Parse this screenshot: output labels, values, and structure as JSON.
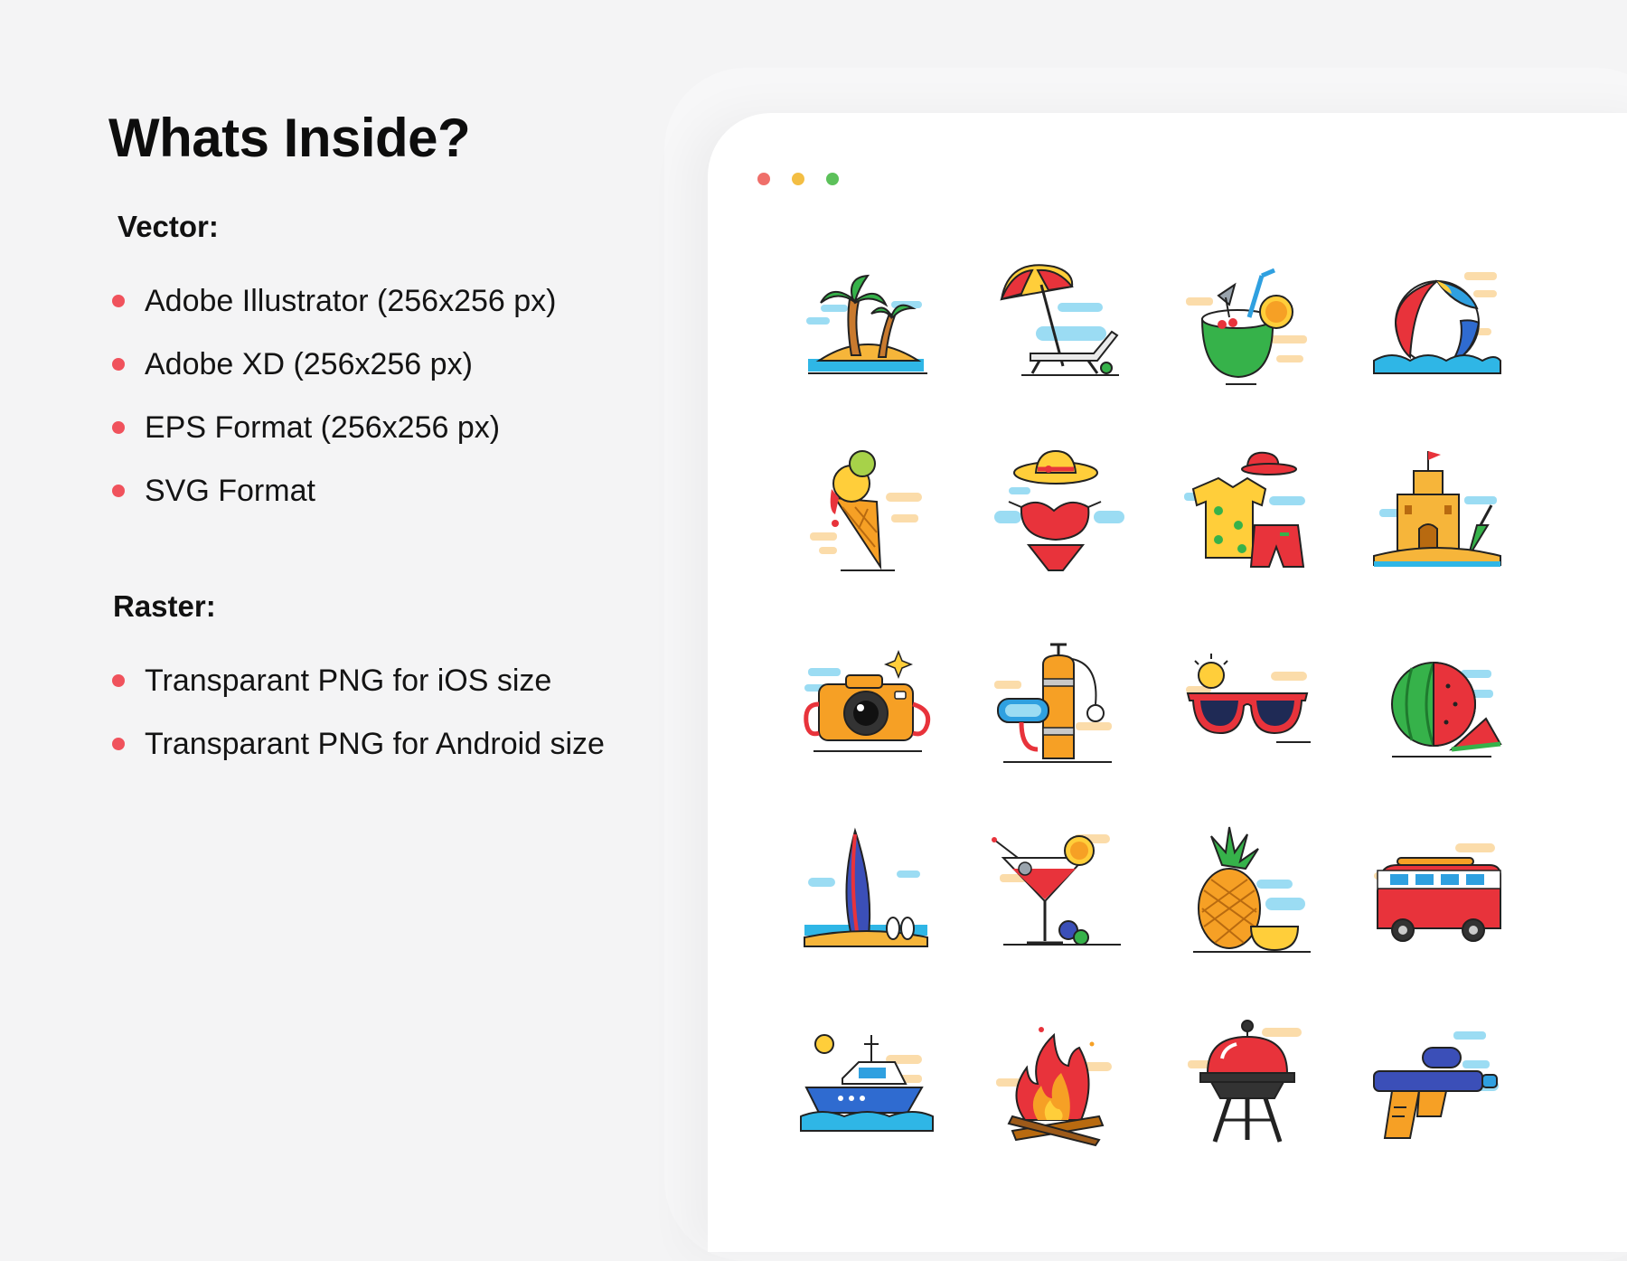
{
  "heading": "Whats Inside?",
  "vector": {
    "title": "Vector:",
    "items": [
      "Adobe Illustrator (256x256 px)",
      "Adobe XD (256x256 px)",
      "EPS Format (256x256 px)",
      "SVG Format"
    ]
  },
  "raster": {
    "title": "Raster:",
    "items": [
      "Transparant PNG for iOS size",
      "Transparant PNG for Android size"
    ]
  },
  "window_dots": [
    "#ef6f6a",
    "#f3be43",
    "#5cc15a"
  ],
  "colors": {
    "bullet": "#f0525c",
    "heading": "#0d0d0d",
    "text": "#141414"
  },
  "icons": [
    "palm-island-icon",
    "beach-umbrella-chair-icon",
    "coconut-drink-icon",
    "beach-ball-icon",
    "ice-cream-cone-icon",
    "bikini-hat-icon",
    "hawaiian-shirt-shorts-icon",
    "sand-castle-icon",
    "camera-icon",
    "scuba-tank-mask-icon",
    "sunglasses-icon",
    "watermelon-icon",
    "surfboard-icon",
    "cocktail-icon",
    "pineapple-icon",
    "camper-van-icon",
    "speed-boat-icon",
    "campfire-icon",
    "barbecue-grill-icon",
    "water-gun-icon"
  ]
}
